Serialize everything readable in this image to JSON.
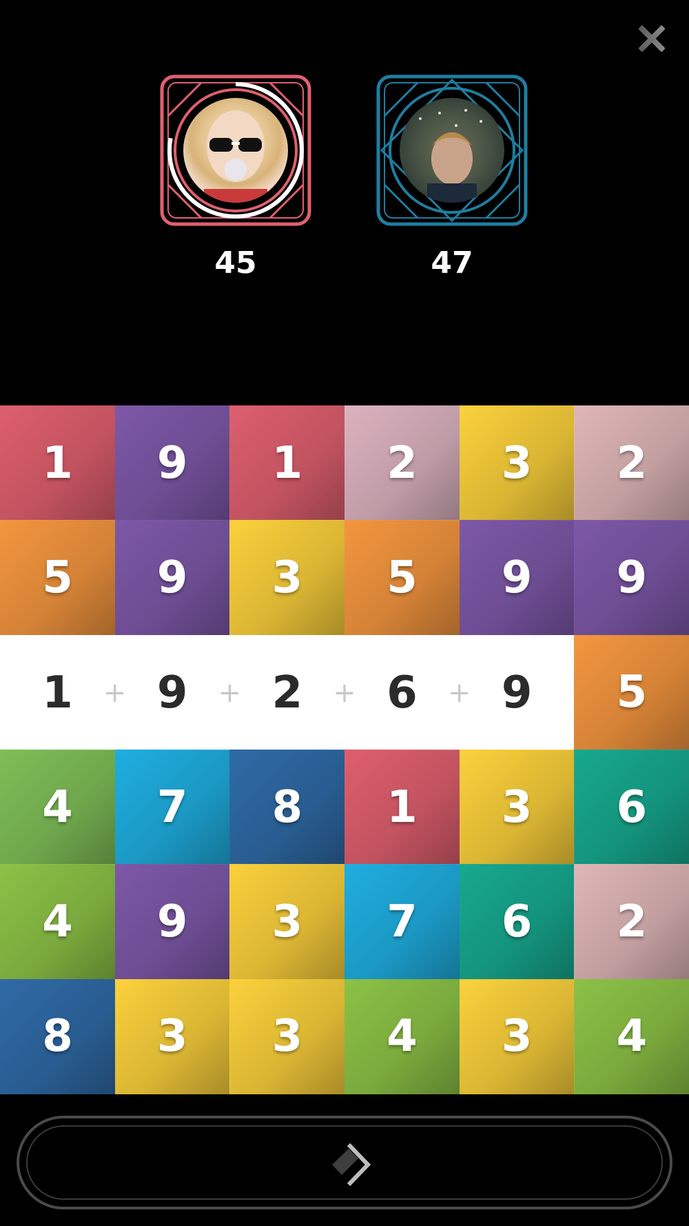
{
  "close_icon": "close-icon",
  "players": [
    {
      "name": "player-1",
      "score": "45",
      "frame_color": "#e0606e",
      "active": true
    },
    {
      "name": "player-2",
      "score": "47",
      "frame_color": "#1f7ea0",
      "active": false
    }
  ],
  "board": {
    "rows": [
      [
        "1",
        "9",
        "1",
        "2",
        "3",
        "2"
      ],
      [
        "5",
        "9",
        "3",
        "5",
        "9",
        "9"
      ],
      [
        "",
        "",
        "",
        "",
        "",
        "5"
      ],
      [
        "4",
        "7",
        "8",
        "1",
        "3",
        "6"
      ],
      [
        "4",
        "9",
        "3",
        "7",
        "6",
        "2"
      ],
      [
        "8",
        "3",
        "3",
        "4",
        "3",
        "4"
      ]
    ],
    "tile_colors": [
      [
        "#de5f6e",
        "#7d58a8",
        "#de5f6e",
        "#dcb3c0",
        "#fbd13c",
        "#e0b7b8"
      ],
      [
        "#f4963f",
        "#7d58a8",
        "#fbd13c",
        "#f4963f",
        "#7d58a8",
        "#7d58a8"
      ],
      [
        "",
        "",
        "",
        "",
        "",
        "#f4963f"
      ],
      [
        "#7fbf57",
        "#1faee0",
        "#2f6aa6",
        "#de5f6e",
        "#fbd13c",
        "#17a98f"
      ],
      [
        "#8cc246",
        "#7d58a8",
        "#fbd13c",
        "#1faee0",
        "#17a98f",
        "#e0b7b8"
      ],
      [
        "#2f6aa6",
        "#fbd13c",
        "#fbd13c",
        "#8cc246",
        "#fbd13c",
        "#8cc246"
      ]
    ],
    "selection": {
      "numbers": [
        "1",
        "9",
        "2",
        "6",
        "9"
      ],
      "operator": "+"
    }
  },
  "next_button": {
    "icon": "chevron-right-icon"
  }
}
